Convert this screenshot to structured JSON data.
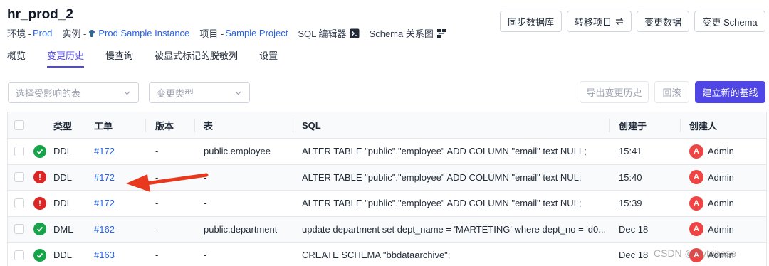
{
  "header": {
    "title": "hr_prod_2",
    "env_label": "环境 -",
    "env_value": "Prod",
    "instance_label": "实例 -",
    "instance_value": "Prod Sample Instance",
    "project_label": "项目 -",
    "project_value": "Sample Project",
    "sql_editor": "SQL 编辑器",
    "schema_diagram": "Schema 关系图"
  },
  "actions": {
    "sync": "同步数据库",
    "transfer": "转移项目",
    "change_data": "变更数据",
    "change_schema": "变更 Schema"
  },
  "tabs": [
    "概览",
    "变更历史",
    "慢查询",
    "被显式标记的脱敏列",
    "设置"
  ],
  "filters": {
    "tables_placeholder": "选择受影响的表",
    "type_placeholder": "变更类型",
    "export": "导出变更历史",
    "rollback": "回滚",
    "baseline": "建立新的基线"
  },
  "table": {
    "columns": [
      "类型",
      "工单",
      "版本",
      "表",
      "SQL",
      "创建于",
      "创建人"
    ],
    "rows": [
      {
        "status": "success",
        "type": "DDL",
        "issue": "#172",
        "version": "-",
        "tables": "public.employee",
        "sql": "ALTER TABLE \"public\".\"employee\" ADD COLUMN \"email\" text NULL;",
        "created": "15:41",
        "avatar": "A",
        "creator": "Admin"
      },
      {
        "status": "failed",
        "type": "DDL",
        "issue": "#172",
        "version": "-",
        "tables": "-",
        "sql": "ALTER TABLE \"public\".\"employee\" ADD COLUMN \"email\" text NUL;",
        "created": "15:40",
        "avatar": "A",
        "creator": "Admin"
      },
      {
        "status": "failed",
        "type": "DDL",
        "issue": "#172",
        "version": "-",
        "tables": "-",
        "sql": "ALTER TABLE \"public\".\"employee\" ADD COLUMN \"email\" text NUL;",
        "created": "15:39",
        "avatar": "A",
        "creator": "Admin"
      },
      {
        "status": "success",
        "type": "DML",
        "issue": "#162",
        "version": "-",
        "tables": "public.department",
        "sql": "update department set dept_name = 'MARTETING' where dept_no = 'd0...",
        "created": "Dec 18",
        "avatar": "A",
        "creator": "Admin"
      },
      {
        "status": "success",
        "type": "DDL",
        "issue": "#163",
        "version": "-",
        "tables": "-",
        "sql": "CREATE SCHEMA \"bbdataarchive\";",
        "created": "Dec 18",
        "avatar": "A",
        "creator": "Admin"
      }
    ]
  },
  "watermark": "CSDN @Bytebase",
  "colors": {
    "accent": "#4f46e5",
    "link": "#2563eb",
    "success": "#16a34a",
    "error": "#dc2626",
    "arrow": "#e8391f"
  }
}
